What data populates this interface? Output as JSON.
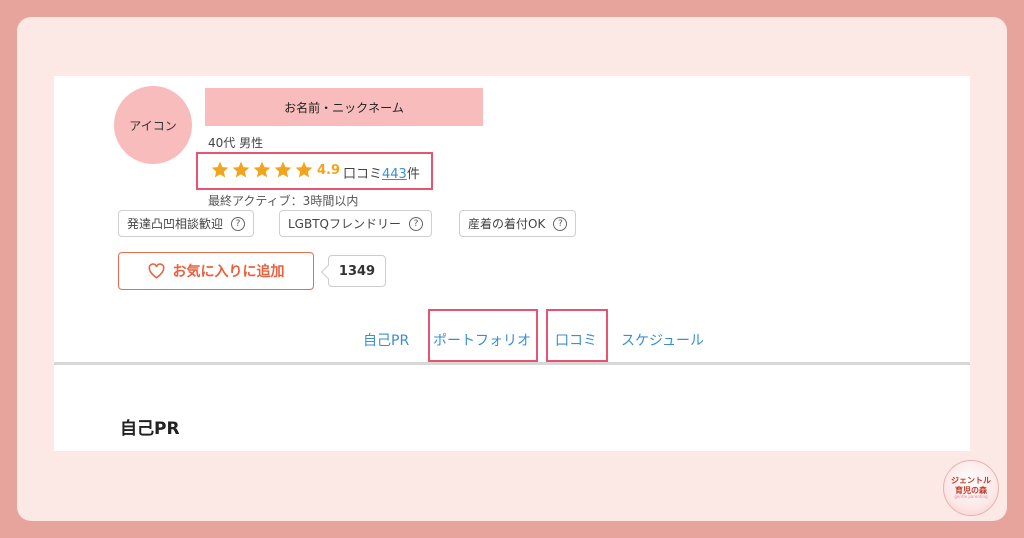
{
  "profile": {
    "avatar_label": "アイコン",
    "name_placeholder": "お名前・ニックネーム",
    "age_gender": "40代 男性",
    "rating": "4.9",
    "reviews_prefix": "口コミ",
    "reviews_count": "443",
    "reviews_suffix": "件",
    "stars": 5,
    "last_active": "最終アクティブ：3時間以内"
  },
  "tags": [
    {
      "label": "発達凸凹相談歓迎"
    },
    {
      "label": "LGBTQフレンドリー"
    },
    {
      "label": "産着の着付OK"
    }
  ],
  "favorite": {
    "label": "お気に入りに追加",
    "count": "1349"
  },
  "tabs": [
    {
      "label": "自己PR"
    },
    {
      "label": "ポートフォリオ"
    },
    {
      "label": "口コミ"
    },
    {
      "label": "スケジュール"
    }
  ],
  "section": {
    "title": "自己PR"
  },
  "logo": {
    "line1": "ジェントル",
    "line2": "育児の森",
    "sub": "gentle parenting"
  },
  "colors": {
    "background": "#e6a49c",
    "frame": "#fce9e5",
    "highlight": "#e8536f",
    "star": "#f2a51c",
    "link": "#3b8fce",
    "accent": "#e9603f",
    "pink_block": "#f9bcbc"
  }
}
